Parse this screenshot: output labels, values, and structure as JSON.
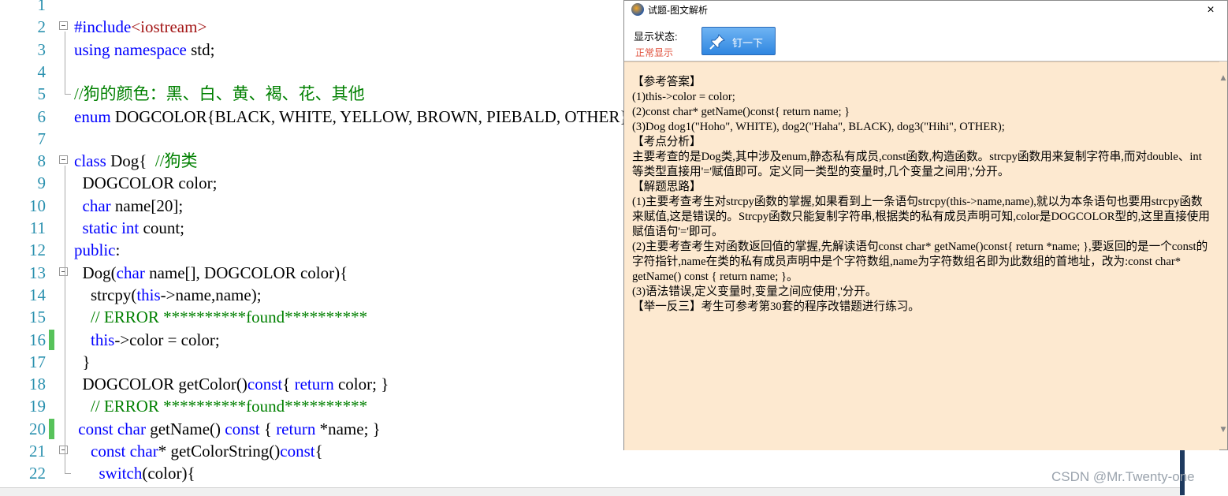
{
  "editor": {
    "lines": [
      {
        "n": "1",
        "fold": false,
        "changed": false,
        "html": ""
      },
      {
        "n": "2",
        "fold": true,
        "changed": false,
        "html": "<span class='kw'>#include</span><span class='st'>&lt;iostream&gt;</span>"
      },
      {
        "n": "3",
        "fold": false,
        "changed": false,
        "html": "<span class='kw'>using namespace</span> std;"
      },
      {
        "n": "4",
        "fold": false,
        "changed": false,
        "html": ""
      },
      {
        "n": "5",
        "fold": false,
        "changed": false,
        "html": "<span class='cm'>//狗的颜色：黑、白、黄、褐、花、其他</span>"
      },
      {
        "n": "6",
        "fold": false,
        "changed": false,
        "html": "<span class='kw'>enum</span> DOGCOLOR{BLACK, WHITE, YELLOW, BROWN, PIEBALD, OTHER};"
      },
      {
        "n": "7",
        "fold": false,
        "changed": false,
        "html": ""
      },
      {
        "n": "8",
        "fold": true,
        "changed": false,
        "html": "<span class='kw'>class</span> Dog{  <span class='cm'>//狗类</span>"
      },
      {
        "n": "9",
        "fold": false,
        "changed": false,
        "html": "  DOGCOLOR color;"
      },
      {
        "n": "10",
        "fold": false,
        "changed": false,
        "html": "  <span class='kw'>char</span> name[20];"
      },
      {
        "n": "11",
        "fold": false,
        "changed": false,
        "html": "  <span class='kw'>static int</span> count;"
      },
      {
        "n": "12",
        "fold": false,
        "changed": false,
        "html": "<span class='kw'>public</span>:"
      },
      {
        "n": "13",
        "fold": true,
        "changed": false,
        "html": "  Dog(<span class='kw'>char</span> name[], DOGCOLOR color){"
      },
      {
        "n": "14",
        "fold": false,
        "changed": false,
        "html": "    strcpy(<span class='kw'>this</span>-&gt;name,name);"
      },
      {
        "n": "15",
        "fold": false,
        "changed": false,
        "html": "    <span class='cm'>// ERROR **********found**********</span>"
      },
      {
        "n": "16",
        "fold": false,
        "changed": true,
        "html": "    <span class='kw'>this</span>-&gt;color = color;"
      },
      {
        "n": "17",
        "fold": false,
        "changed": false,
        "html": "  }"
      },
      {
        "n": "18",
        "fold": false,
        "changed": false,
        "html": "  DOGCOLOR getColor()<span class='kw'>const</span>{ <span class='kw'>return</span> color; }"
      },
      {
        "n": "19",
        "fold": false,
        "changed": false,
        "html": "    <span class='cm'>// ERROR **********found**********</span>"
      },
      {
        "n": "20",
        "fold": false,
        "changed": true,
        "html": " <span class='kw'>const char</span> getName() <span class='kw'>const</span> { <span class='kw'>return</span> *name; }"
      },
      {
        "n": "21",
        "fold": true,
        "changed": false,
        "html": "    <span class='kw'>const char</span>* getColorString()<span class='kw'>const</span>{"
      },
      {
        "n": "22",
        "fold": false,
        "changed": false,
        "html": "      <span class='kw'>switch</span>(color){"
      }
    ]
  },
  "watermark": "CSDN @Mr.Twenty-one",
  "dialog": {
    "title": "试题-图文解析",
    "close": "×",
    "status_label": "显示状态:",
    "status_value": "正常显示",
    "pin_button": "钉一下",
    "scroll_up": "▲",
    "scroll_down": "▼",
    "paragraphs": [
      "【参考答案】",
      "(1)this->color = color;",
      "(2)const char* getName()const{ return name; }",
      "(3)Dog dog1(\"Hoho\", WHITE), dog2(\"Haha\", BLACK), dog3(\"Hihi\", OTHER);",
      "【考点分析】",
      "主要考查的是Dog类,其中涉及enum,静态私有成员,const函数,构造函数。strcpy函数用来复制字符串,而对double、int等类型直接用'='赋值即可。定义同一类型的变量时,几个变量之间用','分开。",
      "【解题思路】",
      "(1)主要考查考生对strcpy函数的掌握,如果看到上一条语句strcpy(this->name,name),就以为本条语句也要用strcpy函数来赋值,这是错误的。Strcpy函数只能复制字符串,根据类的私有成员声明可知,color是DOGCOLOR型的,这里直接使用赋值语句'='即可。",
      "(2)主要考查考生对函数返回值的掌握,先解读语句const char* getName()const{ return *name; },要返回的是一个const的字符指针,name在类的私有成员声明中是个字符数组,name为字符数组名即为此数组的首地址，改为:const char* getName() const { return name; }。",
      "(3)语法错误,定义变量时,变量之间应使用','分开。",
      "【举一反三】考生可参考第30套的程序改错题进行练习。"
    ]
  }
}
